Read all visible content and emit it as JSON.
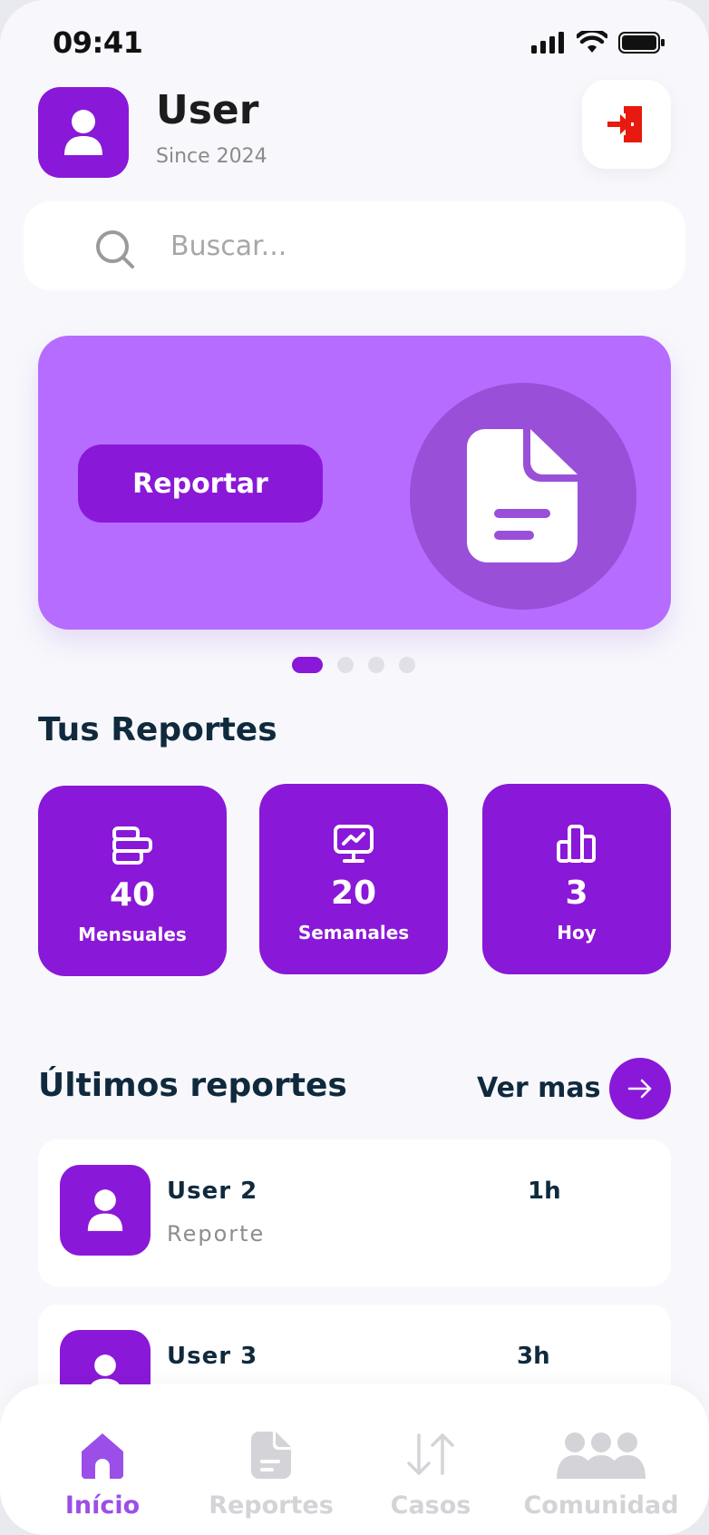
{
  "status_bar": {
    "time": "09:41"
  },
  "header": {
    "name": "User",
    "since": "Since 2024"
  },
  "search": {
    "placeholder": "Buscar..."
  },
  "banner": {
    "button_label": "Reportar"
  },
  "carousel": {
    "pages": 4,
    "active_index": 0
  },
  "stats": {
    "title": "Tus Reportes",
    "items": [
      {
        "value": "40",
        "label": "Mensuales",
        "icon": "bar-chart-horizontal-icon"
      },
      {
        "value": "20",
        "label": "Semanales",
        "icon": "monitor-chart-icon"
      },
      {
        "value": "3",
        "label": "Hoy",
        "icon": "bar-chart-icon"
      }
    ]
  },
  "recent": {
    "title": "Últimos reportes",
    "see_more": "Ver mas",
    "items": [
      {
        "name": "User 2",
        "subtitle": "Reporte",
        "time": "1h"
      },
      {
        "name": "User 3",
        "subtitle": "",
        "time": "3h"
      }
    ]
  },
  "nav": {
    "items": [
      {
        "label": "Início",
        "icon": "home-icon",
        "active": true
      },
      {
        "label": "Reportes",
        "icon": "document-icon",
        "active": false
      },
      {
        "label": "Casos",
        "icon": "swap-vertical-icon",
        "active": false
      },
      {
        "label": "Comunidad",
        "icon": "community-icon",
        "active": false
      }
    ]
  },
  "colors": {
    "primary": "#8a18d8",
    "banner": "#b66cff",
    "background": "#f8f8fc",
    "logout": "#e8190f",
    "text_dark": "#102a3d",
    "nav_inactive": "#d4d4d8"
  }
}
